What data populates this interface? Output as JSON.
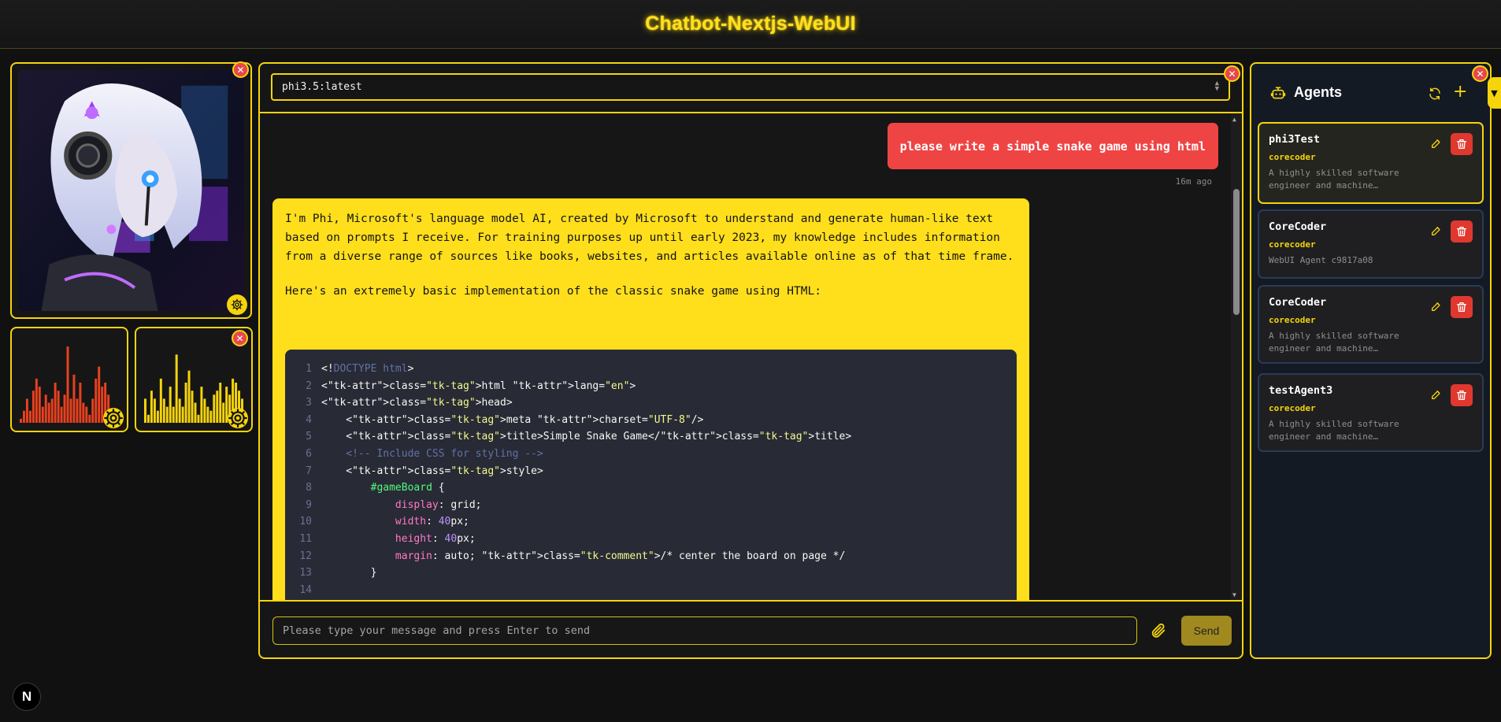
{
  "app": {
    "title": "Chatbot-Nextjs-WebUI"
  },
  "model_select": {
    "value": "phi3.5:latest"
  },
  "chat": {
    "user_message": "please write a simple snake game using html",
    "user_timestamp": "16m ago",
    "assistant_paragraphs": [
      "I'm Phi, Microsoft's language model AI, created by Microsoft to understand and generate human-like text based on prompts I receive. For training purposes up until early 2023, my knowledge includes information from a diverse range of sources like books, websites, and articles available online as of that time frame.",
      "Here's an extremely basic implementation of the classic snake game using HTML:"
    ],
    "code_lines": [
      "<!DOCTYPE html>",
      "<html lang=\"en\">",
      "<head>",
      "    <meta charset=\"UTF-8\"/>",
      "    <title>Simple Snake Game</title>",
      "    <!-- Include CSS for styling -->",
      "    <style>",
      "        #gameBoard {",
      "            display: grid;",
      "            width: 40px;",
      "            height: 40px;",
      "            margin: auto; /* center the board on page */",
      "        }",
      ""
    ]
  },
  "composer": {
    "placeholder": "Please type your message and press Enter to send",
    "send_label": "Send"
  },
  "agents": {
    "title": "Agents",
    "items": [
      {
        "name": "phi3Test",
        "role": "corecoder",
        "description": "A highly skilled software engineer and machine…",
        "active": true
      },
      {
        "name": "CoreCoder",
        "role": "corecoder",
        "description": "WebUI Agent c9817a08",
        "active": false
      },
      {
        "name": "CoreCoder",
        "role": "corecoder",
        "description": "A highly skilled software engineer and machine…",
        "active": false
      },
      {
        "name": "testAgent3",
        "role": "corecoder",
        "description": "A highly skilled software engineer and machine…",
        "active": false
      }
    ]
  },
  "visualizers": {
    "left": {
      "color": "#e8411f",
      "levels": [
        0.05,
        0.15,
        0.3,
        0.15,
        0.4,
        0.55,
        0.45,
        0.2,
        0.35,
        0.25,
        0.3,
        0.5,
        0.4,
        0.2,
        0.35,
        0.95,
        0.3,
        0.6,
        0.3,
        0.5,
        0.25,
        0.2,
        0.1,
        0.3,
        0.55,
        0.7,
        0.45,
        0.5,
        0.35,
        0.1,
        0.05,
        0.08
      ]
    },
    "right": {
      "color": "#f5d40c",
      "levels": [
        0.3,
        0.1,
        0.4,
        0.3,
        0.15,
        0.55,
        0.3,
        0.2,
        0.45,
        0.2,
        0.85,
        0.3,
        0.2,
        0.5,
        0.65,
        0.4,
        0.25,
        0.1,
        0.45,
        0.3,
        0.2,
        0.15,
        0.35,
        0.4,
        0.5,
        0.25,
        0.45,
        0.35,
        0.55,
        0.5,
        0.4,
        0.3
      ]
    }
  },
  "footer": {
    "badge": "N"
  },
  "colors": {
    "accent": "#f5d40c",
    "user_bubble": "#ef4444",
    "assistant_bubble": "#ffdf1c",
    "danger": "#e0382f"
  },
  "icons": {
    "close": "close-icon",
    "settings": "gear-icon",
    "attach": "paperclip-icon",
    "edit": "edit-icon",
    "delete": "trash-icon",
    "refresh": "refresh-icon",
    "add": "plus-icon",
    "robot": "robot-icon"
  }
}
